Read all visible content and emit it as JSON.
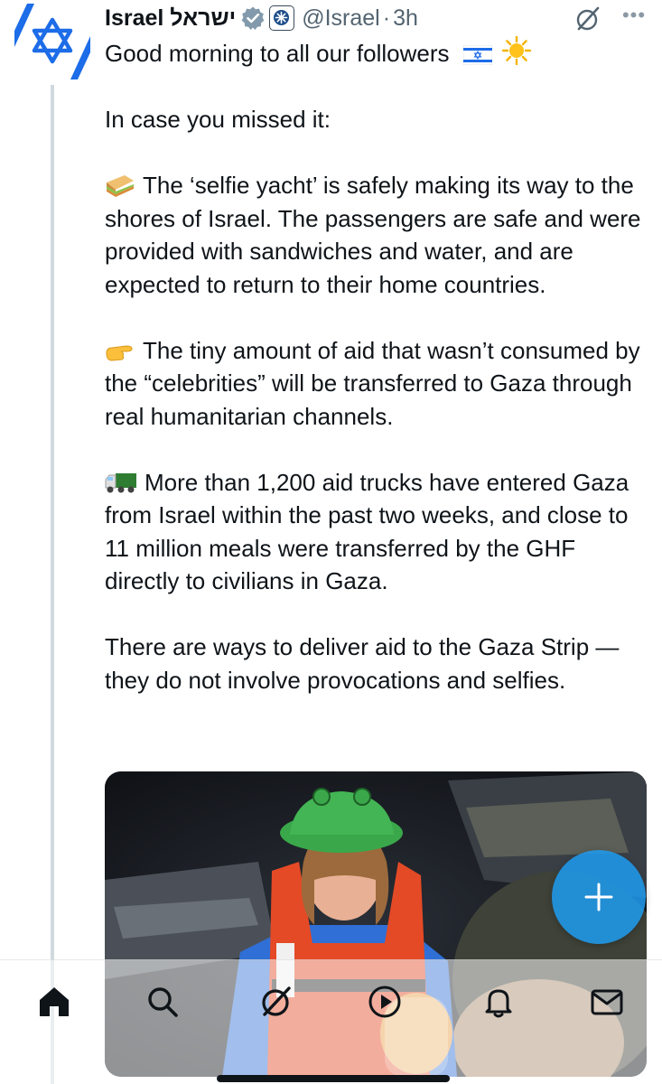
{
  "post": {
    "display_name": "Israel ישראל",
    "handle": "@Israel",
    "separator": "·",
    "time": "3h",
    "more_label": "•••",
    "text": {
      "line1": "Good morning to all our followers",
      "line2": "In case you missed it:",
      "para1": "The ‘selfie yacht’ is safely making its way to the shores of Israel. The passengers are safe and were provided with sandwiches and water, and are expected to return to their home countries.",
      "para2": "The tiny amount of aid that wasn’t consumed by the “celebrities” will be transferred to Gaza through real humanitarian channels.",
      "para3": "More than 1,200 aid trucks have entered Gaza from Israel within the past two weeks, and close to 11 million meals were transferred by the GHF directly to civilians in Gaza.",
      "para4": "There are ways to deliver aid to the Gaza Strip — they do not involve provocations and selfies."
    },
    "icons": {
      "avatar": "star-of-david-flag-icon",
      "verified": "verified-badge-icon",
      "affiliation": "government-affiliation-icon",
      "flag": "israel-flag-emoji",
      "sun": "sun-emoji",
      "sandwich": "sandwich-emoji",
      "hand": "pointing-hand-emoji",
      "truck": "truck-emoji"
    },
    "media": {
      "icon": "photo-person-life-jacket-green-hat"
    }
  },
  "fab": {
    "icon": "plus-icon"
  },
  "tabbar": {
    "items": [
      {
        "name": "home",
        "icon": "home-icon"
      },
      {
        "name": "search",
        "icon": "search-icon"
      },
      {
        "name": "grok",
        "icon": "grok-icon"
      },
      {
        "name": "video",
        "icon": "play-icon"
      },
      {
        "name": "notifications",
        "icon": "bell-icon"
      },
      {
        "name": "messages",
        "icon": "mail-icon"
      }
    ]
  },
  "colors": {
    "accent": "#1d9bf0",
    "text": "#0f1419",
    "secondary": "#536471",
    "flag_blue": "#1d6ce8"
  }
}
